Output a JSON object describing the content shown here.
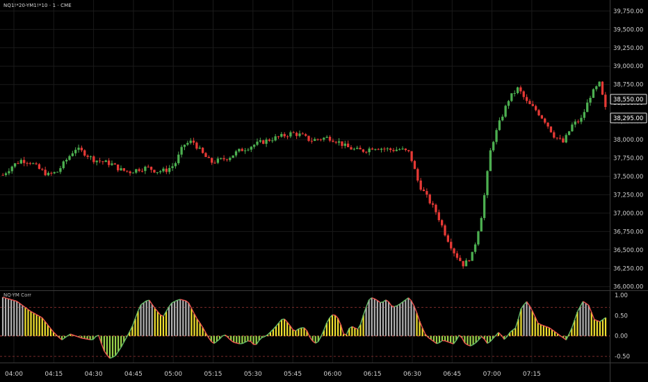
{
  "chart_data": [
    {
      "type": "candlestick",
      "title": "NQ1!*20-YM1!*10 · 1 · CME",
      "x_ticks": [
        "04:00",
        "04:15",
        "04:30",
        "04:45",
        "05:00",
        "05:15",
        "05:30",
        "05:45",
        "06:00",
        "06:15",
        "06:30",
        "06:45",
        "07:00",
        "07:15"
      ],
      "y_ticks": [
        "39,750.00",
        "39,500.00",
        "39,250.00",
        "39,000.00",
        "38,750.00",
        "38,500.00",
        "38,250.00",
        "38,000.00",
        "37,750.00",
        "37,500.00",
        "37,250.00",
        "37,000.00",
        "36,750.00",
        "36,500.00",
        "36,250.00",
        "36,000.00"
      ],
      "ylim": [
        35950,
        39900
      ],
      "price_labels": [
        "38,550.00",
        "38,295.00"
      ],
      "grid": true,
      "colors": {
        "up": "#4caf50",
        "down": "#e53935"
      },
      "close_path": [
        [
          0,
          37520
        ],
        [
          3,
          37640
        ],
        [
          6,
          37720
        ],
        [
          9,
          37700
        ],
        [
          12,
          37600
        ],
        [
          15,
          37520
        ],
        [
          18,
          37560
        ],
        [
          21,
          37720
        ],
        [
          24,
          37880
        ],
        [
          27,
          37820
        ],
        [
          30,
          37730
        ],
        [
          33,
          37700
        ],
        [
          36,
          37670
        ],
        [
          39,
          37590
        ],
        [
          42,
          37560
        ],
        [
          45,
          37600
        ],
        [
          48,
          37620
        ],
        [
          51,
          37570
        ],
        [
          54,
          37580
        ],
        [
          57,
          37660
        ],
        [
          60,
          37930
        ],
        [
          63,
          37980
        ],
        [
          66,
          37820
        ],
        [
          69,
          37690
        ],
        [
          72,
          37720
        ],
        [
          75,
          37760
        ],
        [
          78,
          37840
        ],
        [
          81,
          37890
        ],
        [
          84,
          37940
        ],
        [
          87,
          37980
        ],
        [
          90,
          38020
        ],
        [
          93,
          38050
        ],
        [
          96,
          38090
        ],
        [
          99,
          38060
        ],
        [
          102,
          37990
        ],
        [
          105,
          38010
        ],
        [
          108,
          38030
        ],
        [
          111,
          37980
        ],
        [
          114,
          37900
        ],
        [
          117,
          37860
        ],
        [
          120,
          37850
        ],
        [
          123,
          37900
        ],
        [
          126,
          37880
        ],
        [
          129,
          37860
        ],
        [
          132,
          37870
        ],
        [
          135,
          37820
        ],
        [
          138,
          37400
        ],
        [
          141,
          37200
        ],
        [
          144,
          37000
        ],
        [
          147,
          36700
        ],
        [
          150,
          36450
        ],
        [
          153,
          36290
        ],
        [
          156,
          36450
        ],
        [
          159,
          37000
        ],
        [
          162,
          37900
        ],
        [
          165,
          38250
        ],
        [
          168,
          38560
        ],
        [
          171,
          38700
        ],
        [
          174,
          38500
        ],
        [
          177,
          38400
        ],
        [
          180,
          38250
        ],
        [
          183,
          38050
        ],
        [
          186,
          37960
        ],
        [
          189,
          38200
        ],
        [
          192,
          38280
        ],
        [
          195,
          38600
        ],
        [
          198,
          38760
        ],
        [
          200,
          38420
        ]
      ],
      "ohlc_count": 200
    },
    {
      "type": "bar",
      "title": "NQ-YM Corr",
      "y_ticks": [
        "1.00",
        "0.50",
        "0.00",
        "-0.50"
      ],
      "ylim": [
        -0.65,
        1.1
      ],
      "reference_lines": [
        0.7,
        0,
        -0.5
      ],
      "colors": {
        "positive_high": "#b0b0b0",
        "mid": "#f0e030",
        "negative": "#9ad24a",
        "line_up": "#66bb6a",
        "line_down": "#ef5350"
      },
      "values_path": [
        [
          0,
          0.95
        ],
        [
          5,
          0.85
        ],
        [
          10,
          0.6
        ],
        [
          14,
          0.45
        ],
        [
          18,
          0.1
        ],
        [
          21,
          -0.1
        ],
        [
          24,
          0.05
        ],
        [
          28,
          -0.05
        ],
        [
          32,
          -0.1
        ],
        [
          34,
          0.05
        ],
        [
          36,
          -0.35
        ],
        [
          38,
          -0.55
        ],
        [
          40,
          -0.5
        ],
        [
          42,
          -0.3
        ],
        [
          44,
          -0.05
        ],
        [
          46,
          0.2
        ],
        [
          49,
          0.75
        ],
        [
          52,
          0.9
        ],
        [
          54,
          0.7
        ],
        [
          57,
          0.45
        ],
        [
          60,
          0.8
        ],
        [
          63,
          0.9
        ],
        [
          66,
          0.85
        ],
        [
          69,
          0.45
        ],
        [
          71,
          0.25
        ],
        [
          73,
          0.0
        ],
        [
          75,
          -0.2
        ],
        [
          77,
          -0.1
        ],
        [
          79,
          0.05
        ],
        [
          82,
          -0.15
        ],
        [
          85,
          -0.2
        ],
        [
          88,
          -0.1
        ],
        [
          90,
          -0.25
        ],
        [
          92,
          -0.05
        ],
        [
          94,
          0.0
        ],
        [
          97,
          0.2
        ],
        [
          100,
          0.45
        ],
        [
          102,
          0.3
        ],
        [
          104,
          0.1
        ],
        [
          106,
          0.2
        ],
        [
          108,
          0.2
        ],
        [
          110,
          -0.1
        ],
        [
          112,
          -0.2
        ],
        [
          114,
          0.05
        ],
        [
          116,
          0.4
        ],
        [
          118,
          0.55
        ],
        [
          120,
          0.4
        ],
        [
          122,
          -0.05
        ],
        [
          124,
          0.25
        ],
        [
          127,
          0.15
        ],
        [
          129,
          0.6
        ],
        [
          131,
          0.95
        ],
        [
          133,
          0.9
        ],
        [
          135,
          0.8
        ],
        [
          137,
          0.9
        ],
        [
          139,
          0.7
        ],
        [
          141,
          0.75
        ],
        [
          143,
          0.85
        ],
        [
          145,
          0.95
        ],
        [
          147,
          0.7
        ],
        [
          149,
          0.3
        ],
        [
          151,
          0.0
        ],
        [
          153,
          -0.1
        ],
        [
          155,
          -0.2
        ],
        [
          157,
          -0.1
        ],
        [
          159,
          -0.15
        ],
        [
          161,
          -0.2
        ],
        [
          163,
          0.05
        ],
        [
          165,
          -0.2
        ],
        [
          167,
          -0.25
        ],
        [
          169,
          -0.15
        ],
        [
          171,
          0.0
        ],
        [
          173,
          -0.2
        ],
        [
          175,
          -0.05
        ],
        [
          177,
          0.1
        ],
        [
          179,
          -0.1
        ],
        [
          181,
          0.1
        ],
        [
          183,
          0.2
        ],
        [
          185,
          0.7
        ],
        [
          187,
          0.85
        ],
        [
          189,
          0.6
        ],
        [
          191,
          0.3
        ],
        [
          193,
          0.25
        ],
        [
          195,
          0.2
        ],
        [
          197,
          0.1
        ],
        [
          199,
          0.0
        ],
        [
          201,
          -0.1
        ],
        [
          203,
          0.2
        ],
        [
          205,
          0.6
        ],
        [
          207,
          0.85
        ],
        [
          209,
          0.75
        ],
        [
          211,
          0.4
        ],
        [
          213,
          0.35
        ],
        [
          215,
          0.45
        ]
      ],
      "bar_count": 215
    }
  ]
}
